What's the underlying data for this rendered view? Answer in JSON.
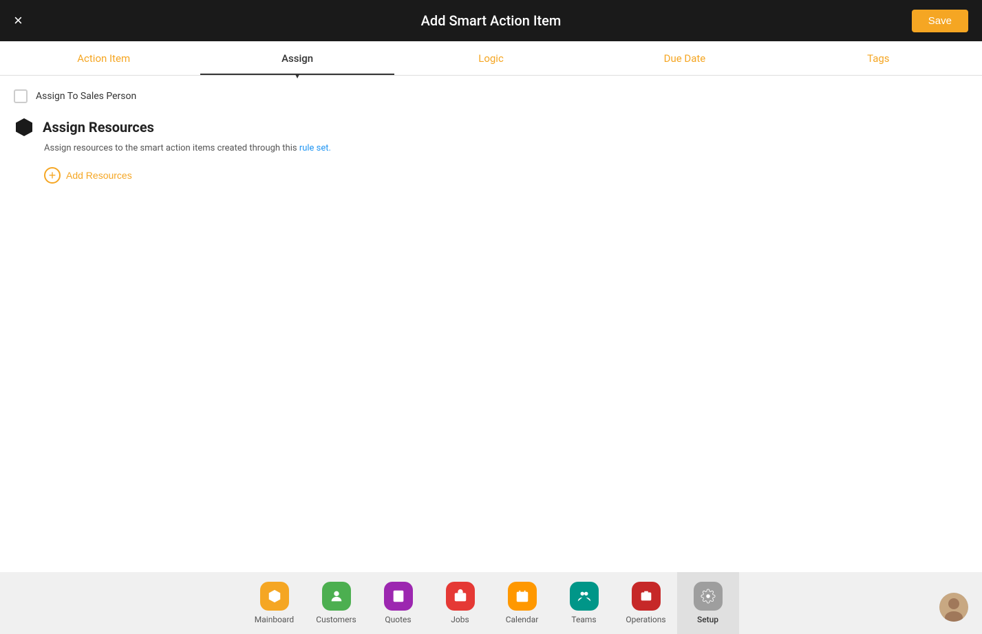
{
  "header": {
    "title": "Add Smart Action Item",
    "close_label": "×",
    "save_label": "Save"
  },
  "tabs": [
    {
      "id": "action-item",
      "label": "Action Item",
      "active": false
    },
    {
      "id": "assign",
      "label": "Assign",
      "active": true
    },
    {
      "id": "logic",
      "label": "Logic",
      "active": false
    },
    {
      "id": "due-date",
      "label": "Due Date",
      "active": false
    },
    {
      "id": "tags",
      "label": "Tags",
      "active": false
    }
  ],
  "assign_sales": {
    "label": "Assign To Sales Person"
  },
  "assign_resources": {
    "title": "Assign Resources",
    "description": "Assign resources to the smart action items created through this rule set.",
    "add_label": "Add Resources"
  },
  "bottom_nav": [
    {
      "id": "mainboard",
      "label": "Mainboard",
      "icon": "⬡",
      "color": "yellow",
      "active": false
    },
    {
      "id": "customers",
      "label": "Customers",
      "icon": "👤",
      "color": "green",
      "active": false
    },
    {
      "id": "quotes",
      "label": "Quotes",
      "icon": "📋",
      "color": "purple",
      "active": false
    },
    {
      "id": "jobs",
      "label": "Jobs",
      "icon": "🔧",
      "color": "red",
      "active": false
    },
    {
      "id": "calendar",
      "label": "Calendar",
      "icon": "📅",
      "color": "orange",
      "active": false
    },
    {
      "id": "teams",
      "label": "Teams",
      "icon": "⚙",
      "color": "teal",
      "active": false
    },
    {
      "id": "operations",
      "label": "Operations",
      "icon": "💼",
      "color": "darkred",
      "active": false
    },
    {
      "id": "setup",
      "label": "Setup",
      "icon": "⚙",
      "color": "gray",
      "active": true
    }
  ]
}
